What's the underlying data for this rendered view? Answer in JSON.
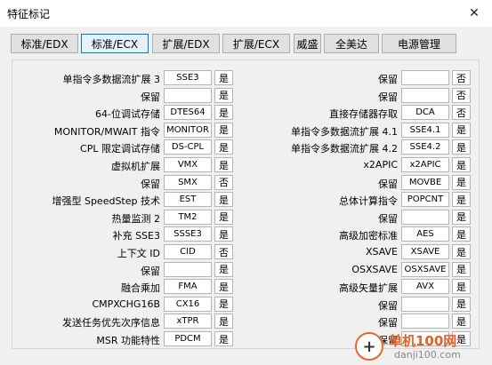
{
  "window": {
    "title": "特征标记",
    "close_glyph": "✕"
  },
  "tabs": [
    {
      "label": "标准/EDX"
    },
    {
      "label": "标准/ECX"
    },
    {
      "label": "扩展/EDX"
    },
    {
      "label": "扩展/ECX"
    },
    {
      "label": "威盛"
    },
    {
      "label": "全美达"
    },
    {
      "label": "电源管理"
    }
  ],
  "active_tab": 1,
  "left": [
    {
      "label": "单指令多数据流扩展 3",
      "value": "SSE3",
      "flag": "是"
    },
    {
      "label": "保留",
      "value": "",
      "flag": "是"
    },
    {
      "label": "64-位调试存储",
      "value": "DTES64",
      "flag": "是"
    },
    {
      "label": "MONITOR/MWAIT 指令",
      "value": "MONITOR",
      "flag": "是"
    },
    {
      "label": "CPL 限定调试存储",
      "value": "DS-CPL",
      "flag": "是"
    },
    {
      "label": "虚拟机扩展",
      "value": "VMX",
      "flag": "是"
    },
    {
      "label": "保留",
      "value": "SMX",
      "flag": "否"
    },
    {
      "label": "增强型 SpeedStep 技术",
      "value": "EST",
      "flag": "是"
    },
    {
      "label": "热量监测 2",
      "value": "TM2",
      "flag": "是"
    },
    {
      "label": "补充 SSE3",
      "value": "SSSE3",
      "flag": "是"
    },
    {
      "label": "上下文 ID",
      "value": "CID",
      "flag": "否"
    },
    {
      "label": "保留",
      "value": "",
      "flag": "是"
    },
    {
      "label": "融合乘加",
      "value": "FMA",
      "flag": "是"
    },
    {
      "label": "CMPXCHG16B",
      "value": "CX16",
      "flag": "是"
    },
    {
      "label": "发送任务优先次序信息",
      "value": "xTPR",
      "flag": "是"
    },
    {
      "label": "MSR 功能特性",
      "value": "PDCM",
      "flag": "是"
    }
  ],
  "right": [
    {
      "label": "保留",
      "value": "",
      "flag": "否"
    },
    {
      "label": "保留",
      "value": "",
      "flag": "否"
    },
    {
      "label": "直接存储器存取",
      "value": "DCA",
      "flag": "否"
    },
    {
      "label": "单指令多数据流扩展 4.1",
      "value": "SSE4.1",
      "flag": "是"
    },
    {
      "label": "单指令多数据流扩展 4.2",
      "value": "SSE4.2",
      "flag": "是"
    },
    {
      "label": "x2APIC",
      "value": "x2APIC",
      "flag": "是"
    },
    {
      "label": "保留",
      "value": "MOVBE",
      "flag": "是"
    },
    {
      "label": "总体计算指令",
      "value": "POPCNT",
      "flag": "是"
    },
    {
      "label": "保留",
      "value": "",
      "flag": "是"
    },
    {
      "label": "高级加密标准",
      "value": "AES",
      "flag": "是"
    },
    {
      "label": "XSAVE",
      "value": "XSAVE",
      "flag": "是"
    },
    {
      "label": "OSXSAVE",
      "value": "OSXSAVE",
      "flag": "是"
    },
    {
      "label": "高级矢量扩展",
      "value": "AVX",
      "flag": "是"
    },
    {
      "label": "保留",
      "value": "",
      "flag": "是"
    },
    {
      "label": "保留",
      "value": "",
      "flag": "是"
    },
    {
      "label": "保留",
      "value": "",
      "flag": "是"
    }
  ],
  "watermark": {
    "title": "单机100网",
    "url": "danji100.com",
    "glyph": "+"
  }
}
